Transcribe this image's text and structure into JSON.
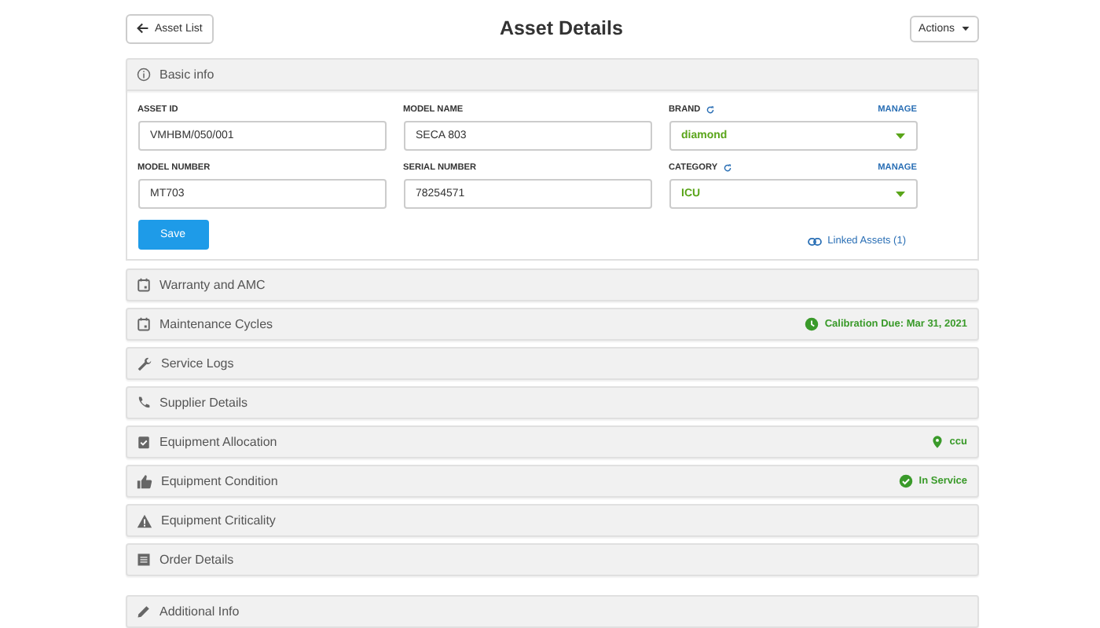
{
  "header": {
    "back_button": "Asset List",
    "title": "Asset Details",
    "actions_button": "Actions"
  },
  "basic_info": {
    "title": "Basic info",
    "expanded": true,
    "fields": [
      {
        "label": "ASSET ID",
        "value": "VMHBM/050/001",
        "kind": "text"
      },
      {
        "label": "MODEL NAME",
        "value": "SECA 803",
        "kind": "text"
      },
      {
        "label": "BRAND",
        "value": "diamond",
        "kind": "select",
        "manage": "MANAGE"
      },
      {
        "label": "MODEL NUMBER",
        "value": "MT703",
        "kind": "text"
      },
      {
        "label": "SERIAL NUMBER",
        "value": "78254571",
        "kind": "text"
      },
      {
        "label": "CATEGORY",
        "value": "ICU",
        "kind": "select",
        "manage": "MANAGE"
      }
    ],
    "save_button": "Save",
    "linked_assets": "Linked Assets (1)"
  },
  "sections": [
    {
      "title": "Warranty and AMC",
      "kind": "calendar"
    },
    {
      "title": "Maintenance Cycles",
      "kind": "calendar",
      "status": {
        "text": "Calibration Due: Mar 31, 2021",
        "kind": "clock"
      }
    },
    {
      "title": "Service Logs",
      "kind": "wrench"
    },
    {
      "title": "Supplier Details",
      "kind": "phone"
    },
    {
      "title": "Equipment Allocation",
      "kind": "clipboard",
      "status": {
        "text": "ccu",
        "kind": "pin"
      }
    },
    {
      "title": "Equipment Condition",
      "kind": "thumb",
      "status": {
        "text": "In Service",
        "kind": "check"
      }
    },
    {
      "title": "Equipment Criticality",
      "kind": "warning"
    },
    {
      "title": "Order Details",
      "kind": "list"
    }
  ],
  "extra_sections": [
    {
      "title": "Additional Info",
      "kind": "pencil"
    }
  ]
}
